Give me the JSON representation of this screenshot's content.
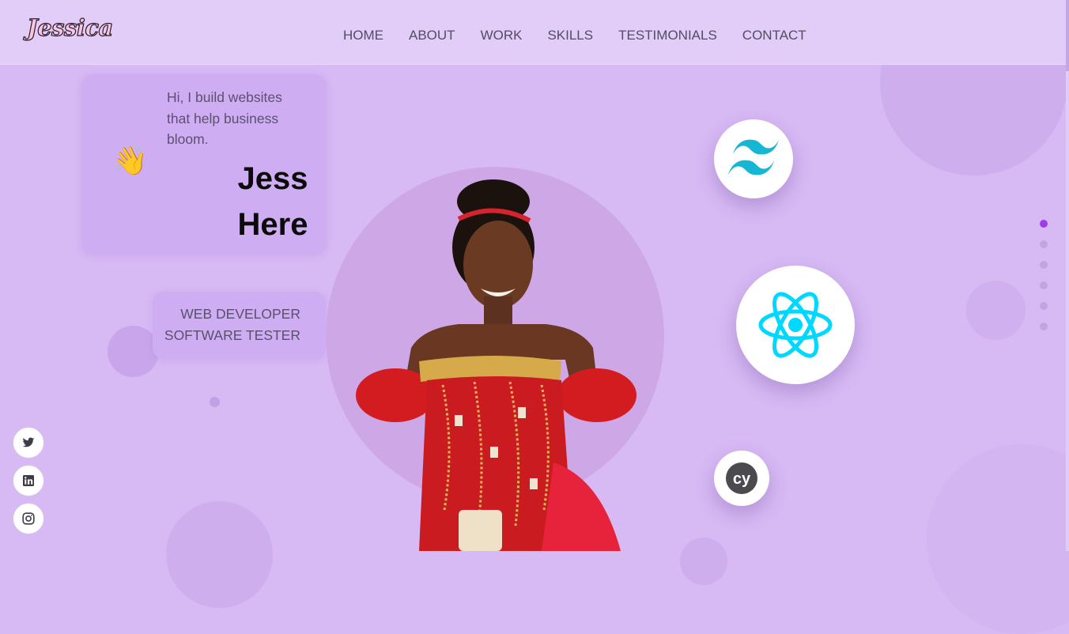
{
  "header": {
    "logo": "Jessica",
    "nav": [
      "HOME",
      "ABOUT",
      "WORK",
      "SKILLS",
      "TESTIMONIALS",
      "CONTACT"
    ]
  },
  "hero": {
    "greeting_icon": "waving-hand-icon",
    "greeting_emoji": "👋",
    "greeting": "Hi, I build websites that help business bloom.",
    "name_line1": "Jess",
    "name_line2": "Here",
    "roles": [
      "WEB DEVELOPER",
      "SOFTWARE TESTER"
    ]
  },
  "tech_icons": [
    "tailwind-icon",
    "react-icon",
    "cypress-icon"
  ],
  "cypress_text": "cy",
  "section_dots": {
    "count": 6,
    "active": 0
  },
  "social": [
    "twitter-icon",
    "linkedin-icon",
    "instagram-icon"
  ],
  "colors": {
    "background": "#d7b9f4",
    "navbar": "#e2cdf8",
    "card": "#cfadf3",
    "accent": "#9b3ee8",
    "tailwind": "#16b6d4",
    "react": "#00d8ff",
    "cypress": "#4a4a4f"
  }
}
